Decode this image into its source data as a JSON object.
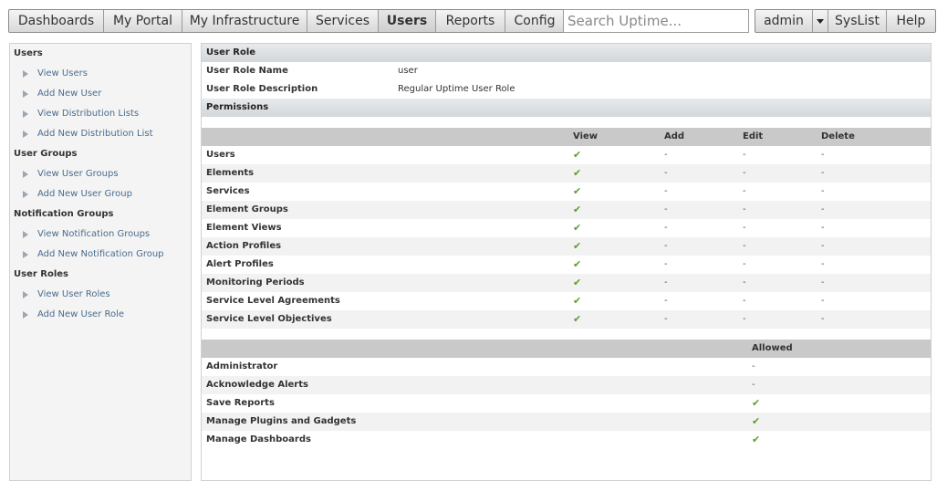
{
  "nav": {
    "tabs": [
      {
        "label": "Dashboards",
        "active": false
      },
      {
        "label": "My Portal",
        "active": false
      },
      {
        "label": "My Infrastructure",
        "active": false
      },
      {
        "label": "Services",
        "active": false
      },
      {
        "label": "Users",
        "active": true
      },
      {
        "label": "Reports",
        "active": false
      },
      {
        "label": "Config",
        "active": false
      }
    ],
    "search_placeholder": "Search Uptime...",
    "user_label": "admin",
    "syslist_label": "SysList",
    "help_label": "Help"
  },
  "sidebar": {
    "sections": [
      {
        "title": "Users",
        "items": [
          "View Users",
          "Add New User",
          "View Distribution Lists",
          "Add New Distribution List"
        ]
      },
      {
        "title": "User Groups",
        "items": [
          "View User Groups",
          "Add New User Group"
        ]
      },
      {
        "title": "Notification Groups",
        "items": [
          "View Notification Groups",
          "Add New Notification Group"
        ]
      },
      {
        "title": "User Roles",
        "items": [
          "View User Roles",
          "Add New User Role"
        ]
      }
    ]
  },
  "role": {
    "header": "User Role",
    "name_label": "User Role Name",
    "name_value": "user",
    "desc_label": "User Role Description",
    "desc_value": "Regular Uptime User Role"
  },
  "permissions": {
    "header": "Permissions",
    "columns": {
      "view": "View",
      "add": "Add",
      "edit": "Edit",
      "delete": "Delete"
    },
    "rows": [
      {
        "name": "Users",
        "view": "✔",
        "add": "-",
        "edit": "-",
        "delete": "-"
      },
      {
        "name": "Elements",
        "view": "✔",
        "add": "-",
        "edit": "-",
        "delete": "-"
      },
      {
        "name": "Services",
        "view": "✔",
        "add": "-",
        "edit": "-",
        "delete": "-"
      },
      {
        "name": "Element Groups",
        "view": "✔",
        "add": "-",
        "edit": "-",
        "delete": "-"
      },
      {
        "name": "Element Views",
        "view": "✔",
        "add": "-",
        "edit": "-",
        "delete": "-"
      },
      {
        "name": "Action Profiles",
        "view": "✔",
        "add": "-",
        "edit": "-",
        "delete": "-"
      },
      {
        "name": "Alert Profiles",
        "view": "✔",
        "add": "-",
        "edit": "-",
        "delete": "-"
      },
      {
        "name": "Monitoring Periods",
        "view": "✔",
        "add": "-",
        "edit": "-",
        "delete": "-"
      },
      {
        "name": "Service Level Agreements",
        "view": "✔",
        "add": "-",
        "edit": "-",
        "delete": "-"
      },
      {
        "name": "Service Level Objectives",
        "view": "✔",
        "add": "-",
        "edit": "-",
        "delete": "-"
      }
    ],
    "allowed_column": "Allowed",
    "allowed_rows": [
      {
        "name": "Administrator",
        "allowed": "-"
      },
      {
        "name": "Acknowledge Alerts",
        "allowed": "-"
      },
      {
        "name": "Save Reports",
        "allowed": "✔"
      },
      {
        "name": "Manage Plugins and Gadgets",
        "allowed": "✔"
      },
      {
        "name": "Manage Dashboards",
        "allowed": "✔"
      }
    ]
  },
  "colors": {
    "check": "#5a9e2f",
    "link": "#4a6c8e",
    "grid_header": "#c9c9c9",
    "section_header": "#d4d7da"
  }
}
